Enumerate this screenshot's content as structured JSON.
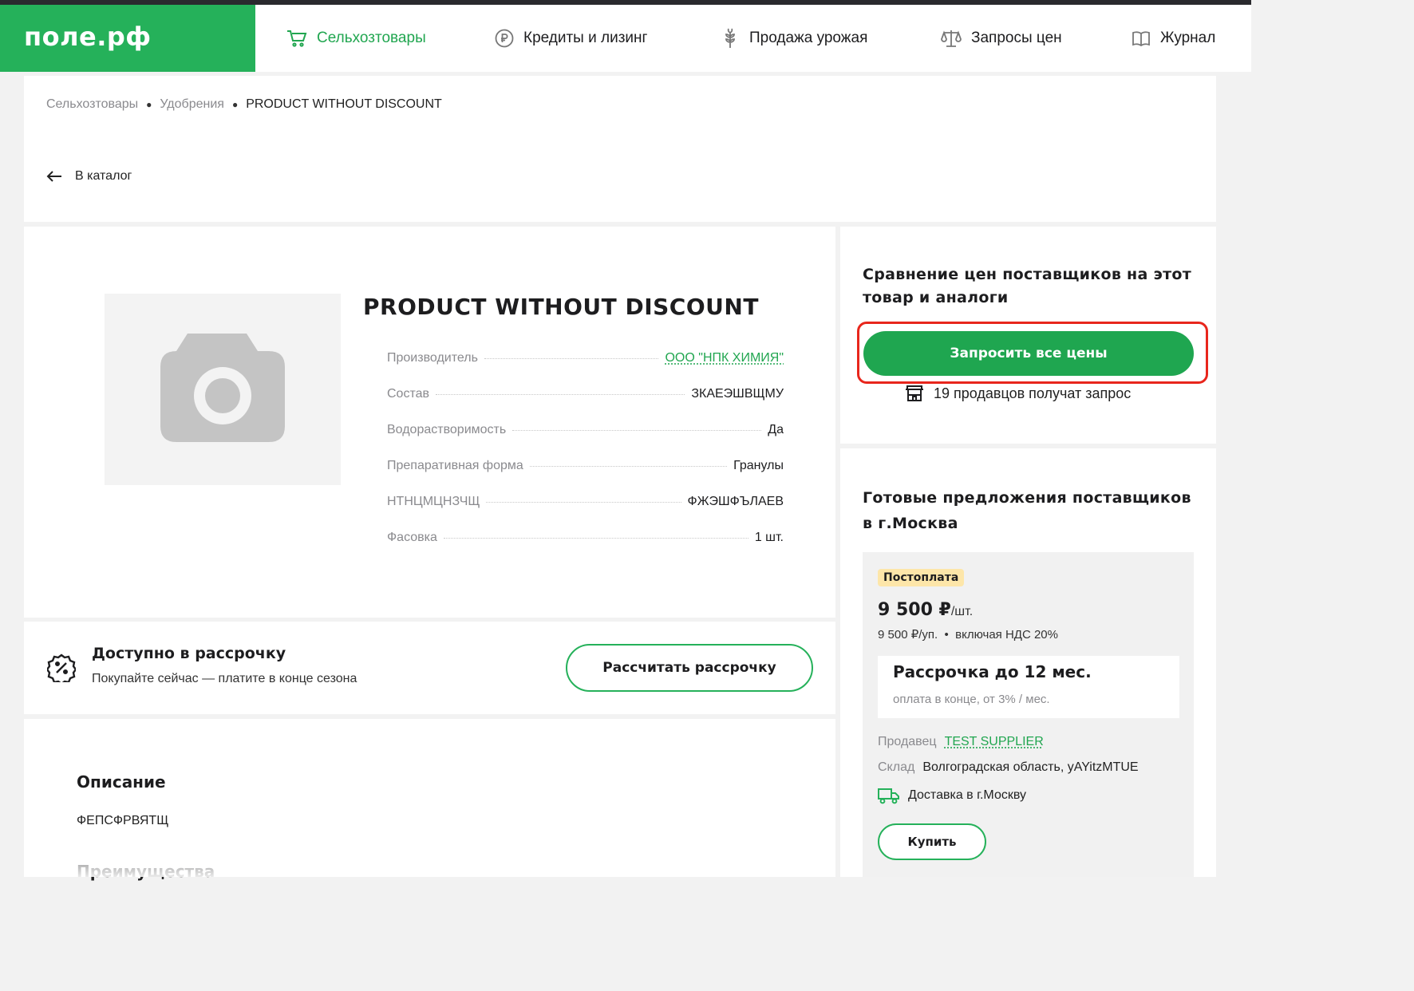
{
  "header": {
    "logo": "поле.рф",
    "nav": [
      {
        "label": "Сельхозтовары",
        "icon": "cart-icon",
        "active": true
      },
      {
        "label": "Кредиты и лизинг",
        "icon": "ruble-icon"
      },
      {
        "label": "Продажа урожая",
        "icon": "wheat-icon"
      },
      {
        "label": "Запросы цен",
        "icon": "scales-icon"
      },
      {
        "label": "Журнал",
        "icon": "book-icon"
      }
    ]
  },
  "breadcrumbs": [
    "Сельхозтовары",
    "Удобрения",
    "PRODUCT WITHOUT DISCOUNT"
  ],
  "back_label": "В каталог",
  "product": {
    "title": "PRODUCT WITHOUT DISCOUNT",
    "properties": [
      {
        "key": "Производитель",
        "value": "ООО \"НПК ХИМИЯ\""
      },
      {
        "key": "Состав",
        "value": "ЗКАЕЭШВЩМУ"
      },
      {
        "key": "Водорастворимость",
        "value": "Да"
      },
      {
        "key": "Препаративная форма",
        "value": "Гранулы"
      },
      {
        "key": "НТНЦМЦНЗЧЩ",
        "value": "ФЖЭШФЪЛАЕВ"
      },
      {
        "key": "Фасовка",
        "value": "1 шт."
      }
    ]
  },
  "installment": {
    "title": "Доступно в рассрочку",
    "subtitle": "Покупайте сейчас — платите в конце сезона",
    "button": "Рассчитать рассрочку"
  },
  "description": {
    "heading": "Описание",
    "text": "ФЕПСФРВЯТЩ",
    "advantages_heading": "Преимущества"
  },
  "compare": {
    "title": "Сравнение цен поставщиков на этот товар и аналоги",
    "button": "Запросить все цены",
    "sellers_note": "19 продавцов получат запрос"
  },
  "offers": {
    "title": "Готовые предложения поставщиков в г.Москва",
    "badge": "Постоплата",
    "price": "9 500 ₽",
    "price_unit": "/шт.",
    "price_sub": "9 500 ₽/уп.  •  включая НДС 20%",
    "installment_title": "Рассрочка до 12 мес.",
    "installment_sub": "оплата в конце, от 3% / мес.",
    "seller_label": "Продавец",
    "seller_name": "TEST SUPPLIER",
    "warehouse_label": "Склад",
    "warehouse_value": "Волгоградская область, yAYitzMTUE",
    "delivery": "Доставка в г.Москву",
    "buy": "Купить"
  },
  "colors": {
    "brand_green": "#25b15a",
    "highlight_red": "#e8261c",
    "badge_yellow": "#fde6a9"
  }
}
